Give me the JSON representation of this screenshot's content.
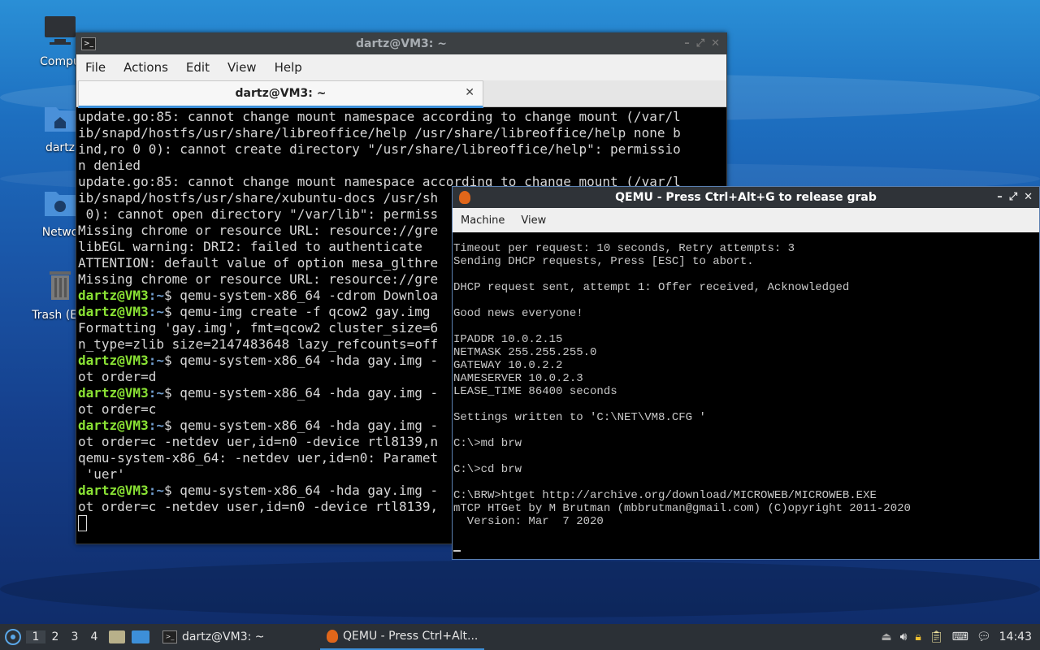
{
  "desktop": {
    "icons": [
      {
        "label": "Compu"
      },
      {
        "label": "dartz"
      },
      {
        "label": "Netwo"
      },
      {
        "label": "Trash (Em"
      }
    ]
  },
  "terminal": {
    "title": "dartz@VM3: ~",
    "menu": [
      "File",
      "Actions",
      "Edit",
      "View",
      "Help"
    ],
    "tab_title": "dartz@VM3: ~",
    "tab_close": "✕",
    "lines": [
      {
        "text": "update.go:85: cannot change mount namespace according to change mount (/var/l"
      },
      {
        "text": "ib/snapd/hostfs/usr/share/libreoffice/help /usr/share/libreoffice/help none b"
      },
      {
        "text": "ind,ro 0 0): cannot create directory \"/usr/share/libreoffice/help\": permissio"
      },
      {
        "text": "n denied"
      },
      {
        "text": "update.go:85: cannot change mount namespace according to change mount (/var/l"
      },
      {
        "text": "ib/snapd/hostfs/usr/share/xubuntu-docs /usr/sh"
      },
      {
        "text": " 0): cannot open directory \"/var/lib\": permiss"
      },
      {
        "text": "Missing chrome or resource URL: resource://gre"
      },
      {
        "text": "libEGL warning: DRI2: failed to authenticate"
      },
      {
        "text": "ATTENTION: default value of option mesa_glthre"
      },
      {
        "text": "Missing chrome or resource URL: resource://gre"
      },
      {
        "prompt": "dartz@VM3",
        "path": ":~",
        "text": "$ qemu-system-x86_64 -cdrom Downloa"
      },
      {
        "prompt": "dartz@VM3",
        "path": ":~",
        "text": "$ qemu-img create -f qcow2 gay.img"
      },
      {
        "text": "Formatting 'gay.img', fmt=qcow2 cluster_size=6"
      },
      {
        "text": "n_type=zlib size=2147483648 lazy_refcounts=off"
      },
      {
        "prompt": "dartz@VM3",
        "path": ":~",
        "text": "$ qemu-system-x86_64 -hda gay.img -"
      },
      {
        "text": "ot order=d"
      },
      {
        "prompt": "dartz@VM3",
        "path": ":~",
        "text": "$ qemu-system-x86_64 -hda gay.img -"
      },
      {
        "text": "ot order=c"
      },
      {
        "prompt": "dartz@VM3",
        "path": ":~",
        "text": "$ qemu-system-x86_64 -hda gay.img -"
      },
      {
        "text": "ot order=c -netdev uer,id=n0 -device rtl8139,n"
      },
      {
        "text": "qemu-system-x86_64: -netdev uer,id=n0: Paramet"
      },
      {
        "text": " 'uer'"
      },
      {
        "prompt": "dartz@VM3",
        "path": ":~",
        "text": "$ qemu-system-x86_64 -hda gay.img -"
      },
      {
        "text": "ot order=c -netdev user,id=n0 -device rtl8139,"
      }
    ]
  },
  "qemu": {
    "title": "QEMU - Press Ctrl+Alt+G to release grab",
    "menu": [
      "Machine",
      "View"
    ],
    "lines": [
      "Timeout per request: 10 seconds, Retry attempts: 3",
      "Sending DHCP requests, Press [ESC] to abort.",
      "",
      "DHCP request sent, attempt 1: Offer received, Acknowledged",
      "",
      "Good news everyone!",
      "",
      "IPADDR 10.0.2.15",
      "NETMASK 255.255.255.0",
      "GATEWAY 10.0.2.2",
      "NAMESERVER 10.0.2.3",
      "LEASE_TIME 86400 seconds",
      "",
      "Settings written to 'C:\\NET\\VM8.CFG '",
      "",
      "C:\\>md brw",
      "",
      "C:\\>cd brw",
      "",
      "C:\\BRW>htget http://archive.org/download/MICROWEB/MICROWEB.EXE",
      "mTCP HTGet by M Brutman (mbbrutman@gmail.com) (C)opyright 2011-2020",
      "  Version: Mar  7 2020",
      ""
    ]
  },
  "taskbar": {
    "workspaces": [
      "1",
      "2",
      "3",
      "4"
    ],
    "tasks": [
      {
        "label": "dartz@VM3: ~"
      },
      {
        "label": "QEMU - Press Ctrl+Alt..."
      }
    ],
    "clock": "14:43"
  }
}
